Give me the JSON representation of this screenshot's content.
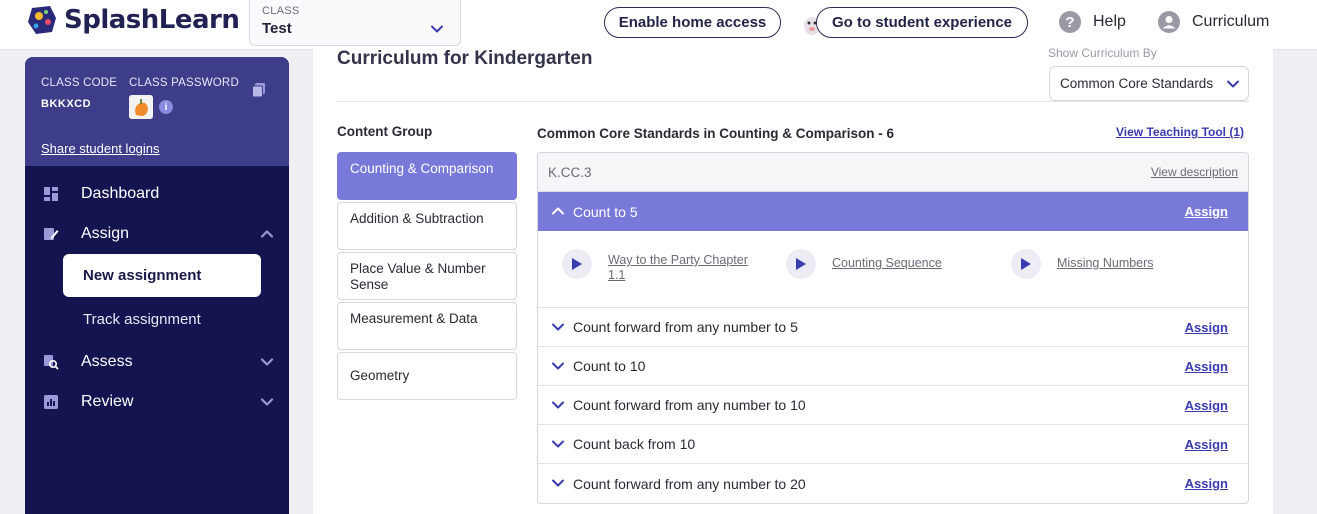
{
  "header": {
    "logo_text": "SplashLearn",
    "class_label": "CLASS",
    "class_value": "Test",
    "enable_home": "Enable home access",
    "go_student": "Go to student experience",
    "help": "Help",
    "user": "Curriculum"
  },
  "sidebar": {
    "class_code_label": "CLASS CODE",
    "class_code": "BKKXCD",
    "class_password_label": "CLASS PASSWORD",
    "share_logins": "Share student logins",
    "nav": [
      {
        "label": "Dashboard",
        "icon": "dashboard-icon"
      },
      {
        "label": "Assign",
        "icon": "assign-icon"
      },
      {
        "label": "Assess",
        "icon": "assess-icon"
      },
      {
        "label": "Review",
        "icon": "review-icon"
      }
    ],
    "sub": {
      "new_assignment": "New assignment",
      "track_assignment": "Track assignment"
    }
  },
  "main": {
    "title": "Curriculum for Kindergarten",
    "show_by_label": "Show Curriculum By",
    "show_by_value": "Common Core Standards",
    "content_group_title": "Content Group",
    "groups": [
      {
        "label": "Counting & Comparison",
        "active": true
      },
      {
        "label": "Addition & Subtraction",
        "active": false
      },
      {
        "label": "Place Value & Number Sense",
        "active": false
      },
      {
        "label": "Measurement & Data",
        "active": false
      },
      {
        "label": "Geometry",
        "active": false
      }
    ],
    "standards_title": "Common Core Standards in Counting & Comparison - 6",
    "teaching_tool": "View Teaching Tool (1)",
    "standard_code": "K.CC.3",
    "view_description": "View description",
    "assign_label": "Assign",
    "items": [
      {
        "label": "Count to 5",
        "expanded": true
      },
      {
        "label": "Count forward from any number to 5",
        "expanded": false
      },
      {
        "label": "Count to 10",
        "expanded": false
      },
      {
        "label": "Count forward from any number to 10",
        "expanded": false
      },
      {
        "label": "Count back from 10",
        "expanded": false
      },
      {
        "label": "Count forward from any number to 20",
        "expanded": false
      }
    ],
    "games": [
      {
        "label": "Way to the Party Chapter 1.1"
      },
      {
        "label": "Counting Sequence"
      },
      {
        "label": "Missing Numbers"
      }
    ]
  },
  "colors": {
    "brand_navy": "#141450",
    "sidebar_card": "#3d3d8a",
    "accent_purple": "#7979d9",
    "link_blue": "#3b3bb0"
  }
}
